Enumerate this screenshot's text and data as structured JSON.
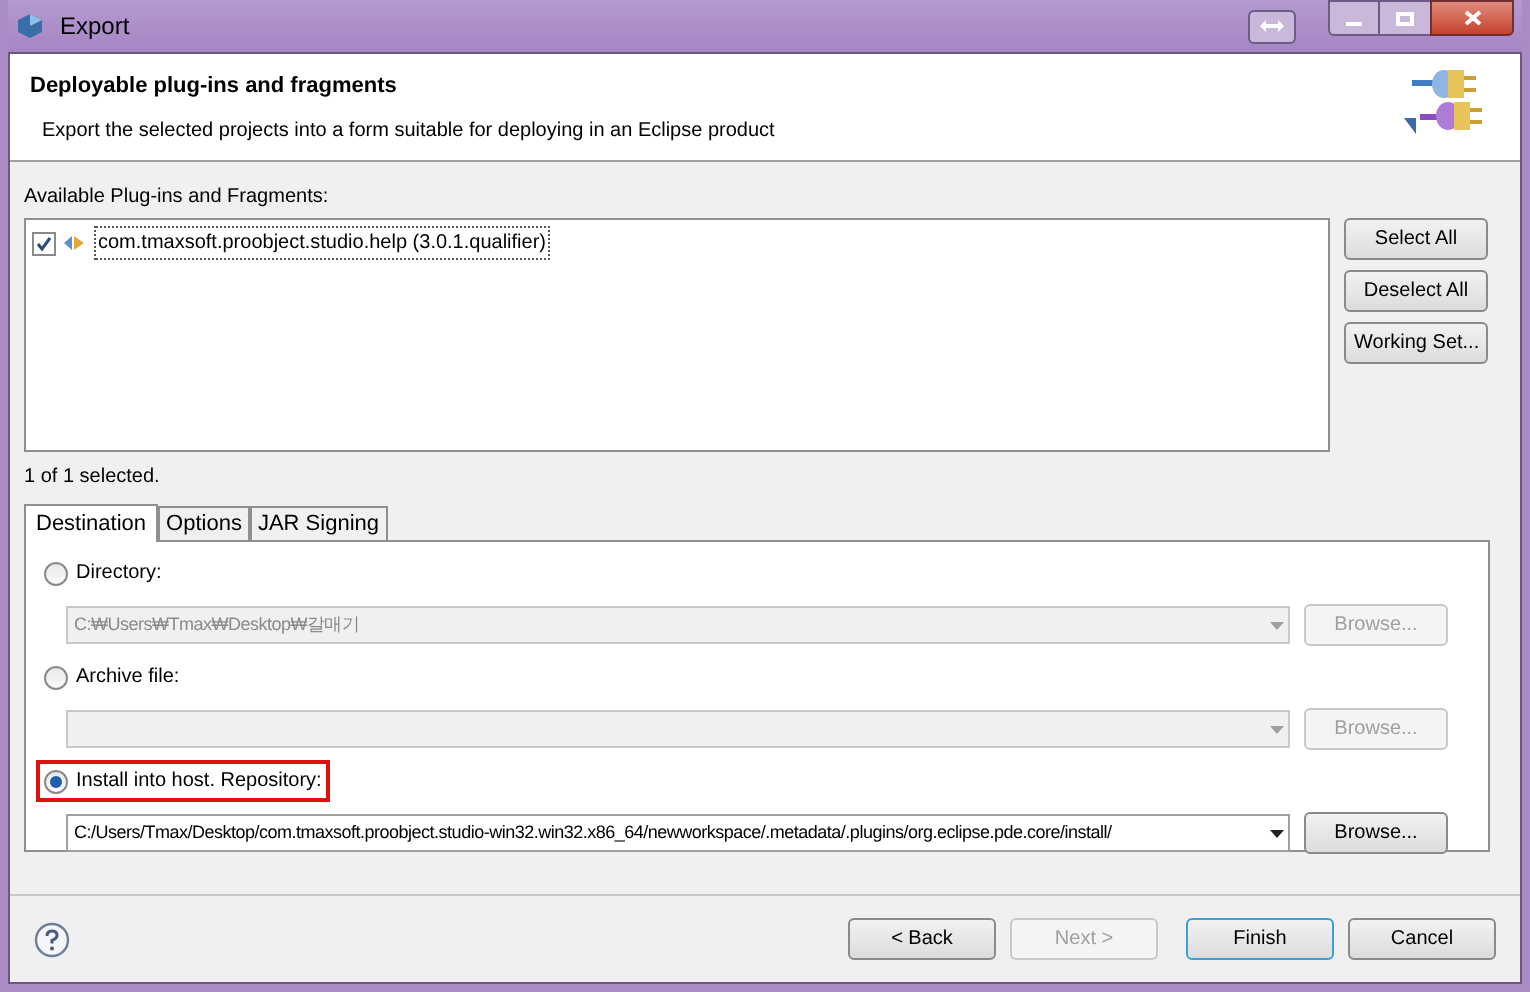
{
  "window": {
    "title": "Export"
  },
  "header": {
    "title": "Deployable plug-ins and fragments",
    "description": "Export the selected projects into a form suitable for deploying in an Eclipse product"
  },
  "plugins": {
    "label": "Available Plug-ins and Fragments:",
    "items": [
      {
        "label": "com.tmaxsoft.proobject.studio.help (3.0.1.qualifier)",
        "checked": true
      }
    ]
  },
  "side_buttons": [
    "Select All",
    "Deselect All",
    "Working Set..."
  ],
  "selection_count": "1 of 1 selected.",
  "tabs": [
    {
      "label": "Destination",
      "selected": true
    },
    {
      "label": "Options",
      "selected": false
    },
    {
      "label": "JAR Signing",
      "selected": false
    }
  ],
  "destinations": [
    {
      "label": "Directory:",
      "selected": false,
      "highlighted": false,
      "path": "C:₩Users₩Tmax₩Desktop₩갈매기",
      "disabled": true,
      "browse": "Browse..."
    },
    {
      "label": "Archive file:",
      "selected": false,
      "highlighted": false,
      "disabled": true,
      "browse": "Browse..."
    },
    {
      "label": "Install into host. Repository:",
      "selected": true,
      "highlighted": true,
      "path": "C:/Users/Tmax/Desktop/com.tmaxsoft.proobject.studio-win32.win32.x86_64/newworkspace/.metadata/.plugins/org.eclipse.pde.core/install/",
      "disabled": false,
      "browse": "Browse..."
    }
  ],
  "footer_buttons": [
    {
      "label": "< Back",
      "disabled": false,
      "default": false
    },
    {
      "label": "Next >",
      "disabled": true,
      "default": false
    },
    {
      "label": "Finish",
      "disabled": false,
      "default": true
    },
    {
      "label": "Cancel",
      "disabled": false,
      "default": false
    }
  ]
}
